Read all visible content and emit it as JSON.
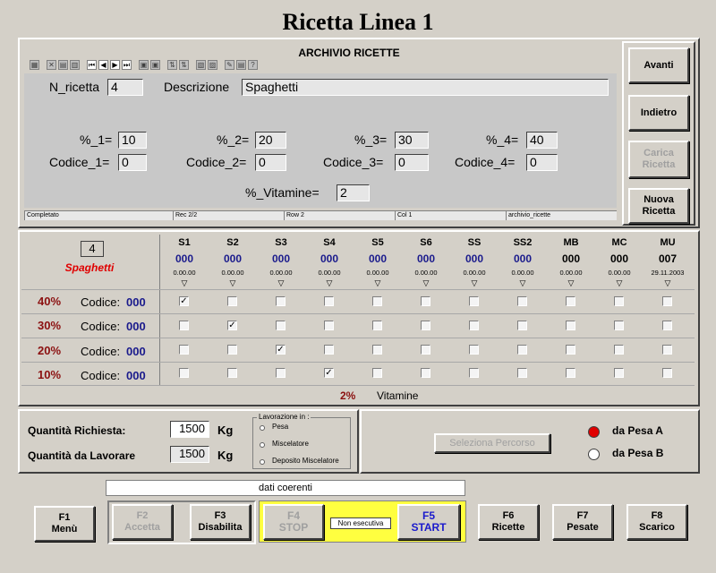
{
  "title": "Ricetta Linea 1",
  "archive": {
    "title": "ARCHIVIO RICETTE",
    "n_ricetta_label": "N_ricetta",
    "n_ricetta_value": "4",
    "descrizione_label": "Descrizione",
    "descrizione_value": "Spaghetti",
    "pct": [
      {
        "label": "%_1=",
        "value": "10",
        "code_label": "Codice_1=",
        "code_value": "0"
      },
      {
        "label": "%_2=",
        "value": "20",
        "code_label": "Codice_2=",
        "code_value": "0"
      },
      {
        "label": "%_3=",
        "value": "30",
        "code_label": "Codice_3=",
        "code_value": "0"
      },
      {
        "label": "%_4=",
        "value": "40",
        "code_label": "Codice_4=",
        "code_value": "0"
      }
    ],
    "vitamine_label": "%_Vitamine=",
    "vitamine_value": "2",
    "status": [
      "Completato",
      "Rec 2/2",
      "Row 2",
      "Col 1",
      "archivio_ricette"
    ]
  },
  "side_buttons": {
    "avanti": "Avanti",
    "indietro": "Indietro",
    "carica": "Carica Ricetta",
    "nuova": "Nuova Ricetta"
  },
  "grid": {
    "recipe_number": "4",
    "recipe_name": "Spaghetti",
    "columns": [
      {
        "name": "S1",
        "value": "000",
        "date": "0.00.00"
      },
      {
        "name": "S2",
        "value": "000",
        "date": "0.00.00"
      },
      {
        "name": "S3",
        "value": "000",
        "date": "0.00.00"
      },
      {
        "name": "S4",
        "value": "000",
        "date": "0.00.00"
      },
      {
        "name": "S5",
        "value": "000",
        "date": "0.00.00"
      },
      {
        "name": "S6",
        "value": "000",
        "date": "0.00.00"
      },
      {
        "name": "SS",
        "value": "000",
        "date": "0.00.00"
      },
      {
        "name": "SS2",
        "value": "000",
        "date": "0.00.00"
      },
      {
        "name": "MB",
        "value": "000",
        "date": "0.00.00"
      },
      {
        "name": "MC",
        "value": "000",
        "date": "0.00.00"
      },
      {
        "name": "MU",
        "value": "007",
        "date": "29.11.2003"
      }
    ],
    "rows": [
      {
        "pct": "40%",
        "code_label": "Codice:",
        "code_value": "000",
        "checked": 0
      },
      {
        "pct": "30%",
        "code_label": "Codice:",
        "code_value": "000",
        "checked": 1
      },
      {
        "pct": "20%",
        "code_label": "Codice:",
        "code_value": "000",
        "checked": 2
      },
      {
        "pct": "10%",
        "code_label": "Codice:",
        "code_value": "000",
        "checked": 3
      }
    ],
    "vitamine_pct": "2%",
    "vitamine_label": "Vitamine"
  },
  "quantity": {
    "richiesta_label": "Quantità Richiesta:",
    "richiesta_value": "1500",
    "lavorare_label": "Quantità da Lavorare",
    "lavorare_value": "1500",
    "unit": "Kg",
    "lavorazione_title": "Lavorazione in :",
    "lavorazione_options": [
      "Pesa",
      "Miscelatore",
      "Deposito Miscelatore"
    ]
  },
  "percorso": {
    "button": "Seleziona Percorso",
    "pesa_a": "da Pesa A",
    "pesa_b": "da Pesa B"
  },
  "status_message": "dati coerenti",
  "fkeys": {
    "f1": {
      "key": "F1",
      "label": "Menù"
    },
    "f2": {
      "key": "F2",
      "label": "Accetta"
    },
    "f3": {
      "key": "F3",
      "label": "Disabilita"
    },
    "f4": {
      "key": "F4",
      "label": "STOP"
    },
    "exec_state": "Non esecutiva",
    "f5": {
      "key": "F5",
      "label": "START"
    },
    "f6": {
      "key": "F6",
      "label": "Ricette"
    },
    "f7": {
      "key": "F7",
      "label": "Pesate"
    },
    "f8": {
      "key": "F8",
      "label": "Scarico"
    }
  },
  "colors": {
    "background": "#d4d0c8",
    "accent_red": "#e00000",
    "blue_value": "#1a1a8c",
    "dark_red_pct": "#8b1010",
    "start_panel": "#ffff40"
  }
}
